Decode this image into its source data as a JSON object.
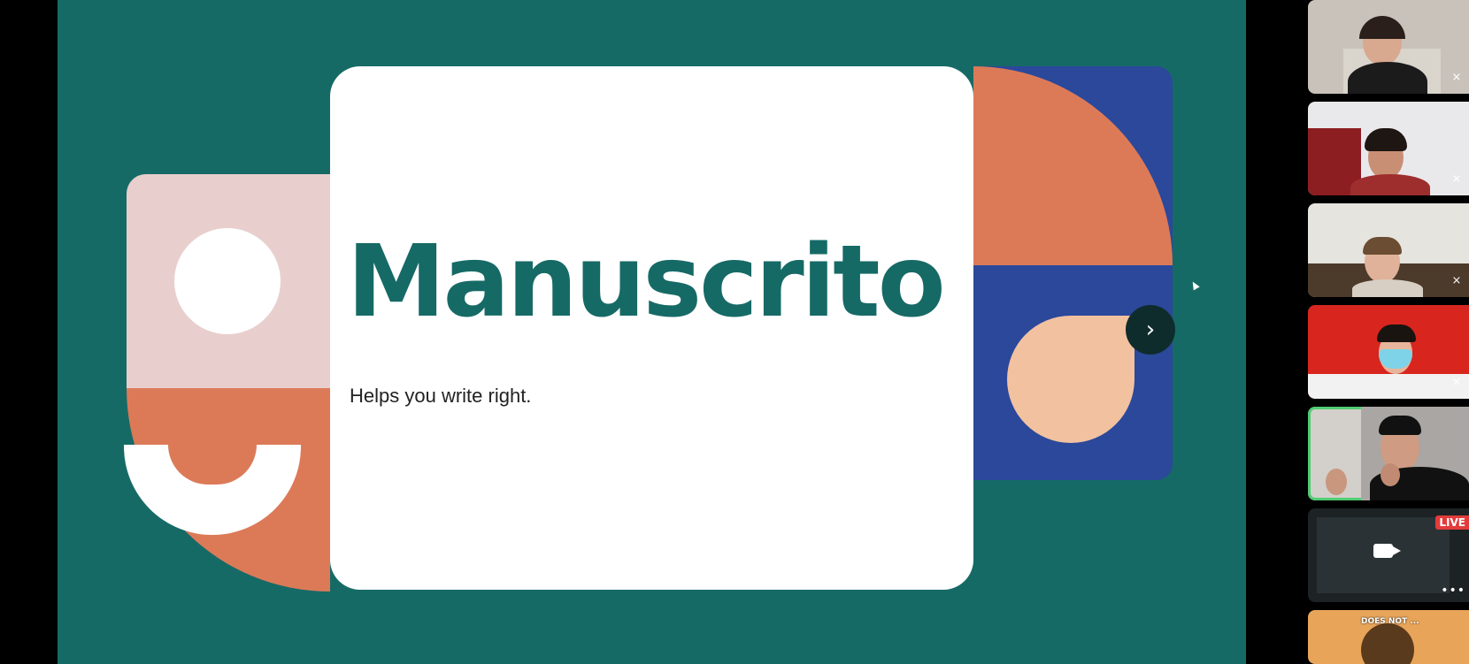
{
  "slide": {
    "title": "Manuscrito",
    "subtitle": "Helps you write right.",
    "next_label": "›",
    "colors": {
      "background": "#166a66",
      "card": "#ffffff",
      "title": "#166a66",
      "orange": "#dc7a58",
      "pink": "#e8cfcd",
      "blue": "#2b489b",
      "peach": "#f2c1a0"
    }
  },
  "participants": {
    "mic_muted_icon": "mic-off-icon",
    "tiles": [
      {
        "muted": true
      },
      {
        "muted": true
      },
      {
        "muted": true
      },
      {
        "muted": true
      },
      {
        "muted": false,
        "active_speaker": true
      },
      {
        "live_label": "LIVE",
        "video_off_icon": "video-camera-icon",
        "more_label": "•••"
      },
      {
        "caption": "DOES NOT ..."
      }
    ]
  }
}
